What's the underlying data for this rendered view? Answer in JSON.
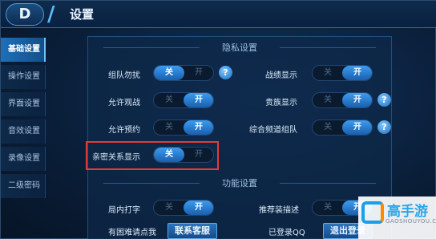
{
  "header": {
    "back_glyph": "D",
    "title": "设置"
  },
  "sidebar": {
    "items": [
      {
        "label": "基础设置",
        "active": true
      },
      {
        "label": "操作设置",
        "active": false
      },
      {
        "label": "界面设置",
        "active": false
      },
      {
        "label": "音效设置",
        "active": false
      },
      {
        "label": "录像设置",
        "active": false
      },
      {
        "label": "二级密码",
        "active": false
      }
    ]
  },
  "privacy": {
    "title": "隐私设置",
    "rows": [
      {
        "label": "组队勿扰",
        "off": "关",
        "on": "开",
        "state": "off",
        "help": true
      },
      {
        "label": "战绩显示",
        "off": "关",
        "on": "开",
        "state": "on",
        "help": false
      },
      {
        "label": "允许观战",
        "off": "关",
        "on": "开",
        "state": "on",
        "help": false
      },
      {
        "label": "贵族显示",
        "off": "关",
        "on": "开",
        "state": "on",
        "help": true
      },
      {
        "label": "允许预约",
        "off": "关",
        "on": "开",
        "state": "on",
        "help": false
      },
      {
        "label": "综合频道组队",
        "off": "关",
        "on": "开",
        "state": "on",
        "help": true
      },
      {
        "label": "亲密关系显示",
        "off": "关",
        "on": "开",
        "state": "off",
        "help": false
      }
    ]
  },
  "function": {
    "title": "功能设置",
    "rows": [
      {
        "label": "局内打字",
        "off": "关",
        "on": "开",
        "state": "on"
      },
      {
        "label": "推荐装描述",
        "off": "关",
        "on": "开",
        "state": "on"
      }
    ]
  },
  "footer": {
    "trouble_label": "有困难请点我",
    "contact_button": "联系客服",
    "login_label": "已登录QQ",
    "logout_button": "退出登录"
  },
  "watermark": {
    "text": "高手游",
    "sub": "GAOSHOUYOU.COM"
  },
  "colors": {
    "accent": "#3c9bf0",
    "highlight": "#e23b3b",
    "background": "#0a1f3a"
  }
}
